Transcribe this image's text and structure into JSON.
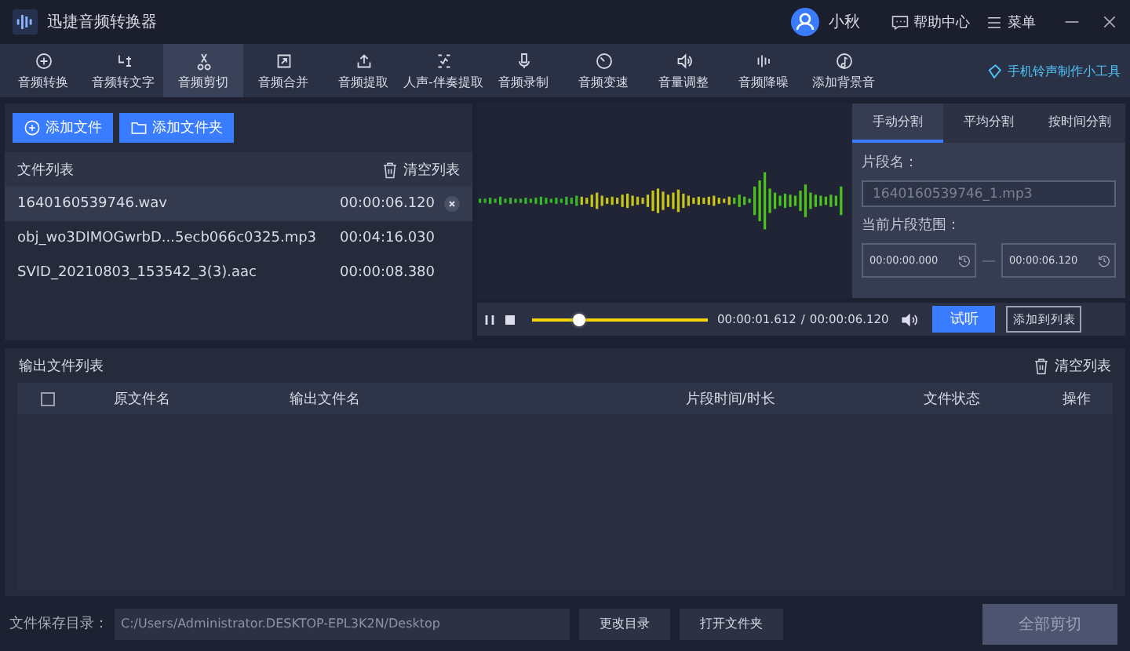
{
  "window": {
    "title": "迅捷音频转换器",
    "user": "小秋",
    "help": "帮助中心",
    "menu": "菜单"
  },
  "toolbar": [
    {
      "label": "音频转换",
      "selected": false
    },
    {
      "label": "音频转文字",
      "selected": false
    },
    {
      "label": "音频剪切",
      "selected": true
    },
    {
      "label": "音频合并",
      "selected": false
    },
    {
      "label": "音频提取",
      "selected": false
    },
    {
      "label": "人声-伴奏提取",
      "selected": false
    },
    {
      "label": "音频录制",
      "selected": false
    },
    {
      "label": "音频变速",
      "selected": false
    },
    {
      "label": "音量调整",
      "selected": false
    },
    {
      "label": "音频降噪",
      "selected": false
    },
    {
      "label": "添加背景音",
      "selected": false
    }
  ],
  "ringtone_link": "手机铃声制作小工具",
  "file_panel": {
    "add_file": "添加文件",
    "add_folder": "添加文件夹",
    "title": "文件列表",
    "clear": "清空列表",
    "files": [
      {
        "name": "1640160539746.wav",
        "duration": "00:00:06.120",
        "selected": true
      },
      {
        "name": "obj_wo3DIMOGwrbD...5ecb066c0325.mp3",
        "duration": "00:04:16.030",
        "selected": false
      },
      {
        "name": "SVID_20210803_153542_3(3).aac",
        "duration": "00:00:08.380",
        "selected": false
      }
    ]
  },
  "split_tabs": [
    {
      "label": "手动分割",
      "selected": true
    },
    {
      "label": "平均分割",
      "selected": false
    },
    {
      "label": "按时间分割",
      "selected": false
    }
  ],
  "segment": {
    "name_label": "片段名：",
    "name_placeholder": "1640160539746_1.mp3",
    "range_label": "当前片段范围：",
    "start": "00:00:00.000",
    "end": "00:00:06.120"
  },
  "player": {
    "level": 0.27,
    "current": "00:00:01.612",
    "separator": "/",
    "total": "00:00:06.120",
    "preview": "试听",
    "add_to_list": "添加到列表"
  },
  "output": {
    "title": "输出文件列表",
    "clear": "清空列表",
    "checked": false,
    "columns": [
      "原文件名",
      "输出文件名",
      "片段时间/时长",
      "文件状态",
      "操作"
    ]
  },
  "footer": {
    "label": "文件保存目录：",
    "path": "C:/Users/Administrator.DESKTOP-EPL3K2N/Desktop",
    "change_dir": "更改目录",
    "open_folder": "打开文件夹",
    "cut_all": "全部剪切"
  }
}
